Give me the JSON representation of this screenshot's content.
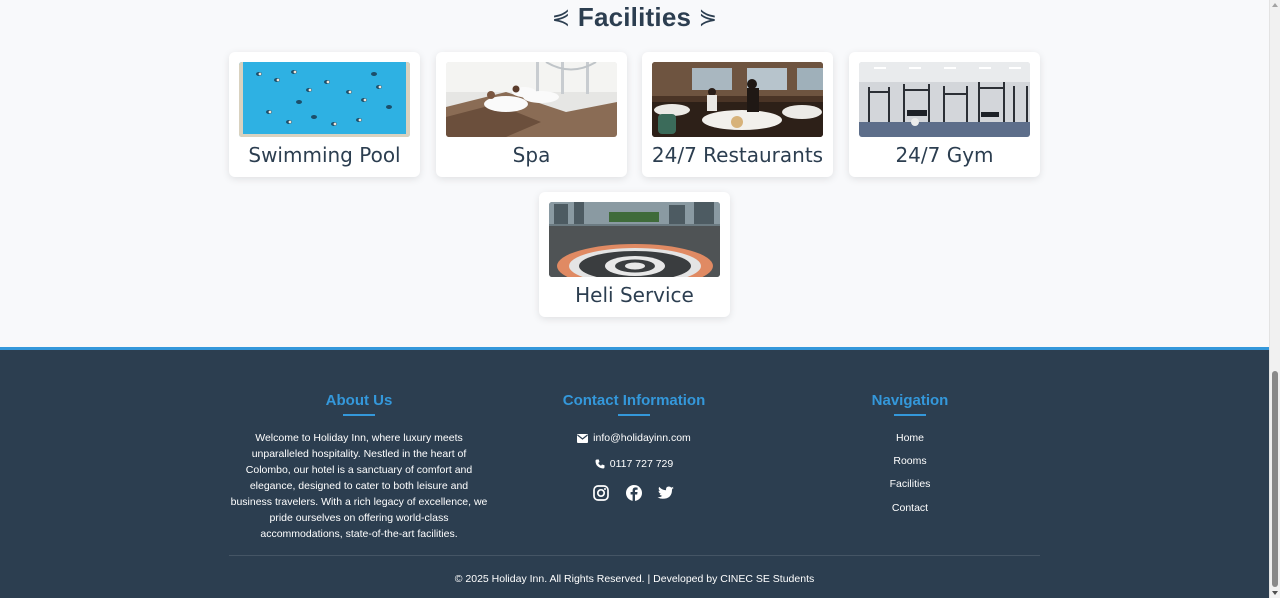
{
  "facilities": {
    "title": "Facilities",
    "arrow_left": "⋞",
    "arrow_right": "⋟",
    "items": [
      {
        "label": "Swimming Pool",
        "image": "swimming-pool-photo"
      },
      {
        "label": "Spa",
        "image": "spa-photo"
      },
      {
        "label": "24/7 Restaurants",
        "image": "restaurant-photo"
      },
      {
        "label": "24/7 Gym",
        "image": "gym-photo"
      },
      {
        "label": "Heli Service",
        "image": "helipad-photo"
      }
    ]
  },
  "footer": {
    "about": {
      "heading": "About Us",
      "text": "Welcome to Holiday Inn, where luxury meets unparalleled hospitality. Nestled in the heart of Colombo, our hotel is a sanctuary of comfort and elegance, designed to cater to both leisure and business travelers. With a rich legacy of excellence, we pride ourselves on offering world-class accommodations, state-of-the-art facilities."
    },
    "contact": {
      "heading": "Contact Information",
      "email": "info@holidayinn.com",
      "phone": "0117 727 729",
      "socials": [
        "instagram-icon",
        "facebook-icon",
        "twitter-icon"
      ]
    },
    "navigation": {
      "heading": "Navigation",
      "links": [
        "Home",
        "Rooms",
        "Facilities",
        "Contact"
      ]
    },
    "copyright": "© 2025 Holiday Inn. All Rights Reserved. | Developed by CINEC SE Students"
  },
  "colors": {
    "accent": "#3498db",
    "footer_bg": "#2c3e50",
    "page_bg": "#f8f9fb"
  }
}
